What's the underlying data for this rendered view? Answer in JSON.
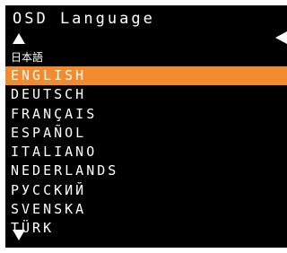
{
  "osd": {
    "title": "OSD Language",
    "scroll_up_icon": "triangle-up",
    "scroll_down_icon": "triangle-down",
    "back_icon": "triangle-left",
    "highlight_color": "#f28a2e",
    "items": [
      {
        "label": "日本語"
      },
      {
        "label": "ENGLISH",
        "selected": true
      },
      {
        "label": "DEUTSCH"
      },
      {
        "label": "FRANÇAIS"
      },
      {
        "label": "ESPAÑOL"
      },
      {
        "label": "ITALIANO"
      },
      {
        "label": "NEDERLANDS"
      },
      {
        "label": "РУССКИЙ"
      },
      {
        "label": "SVENSKA"
      },
      {
        "label": "TÜRK"
      }
    ]
  }
}
